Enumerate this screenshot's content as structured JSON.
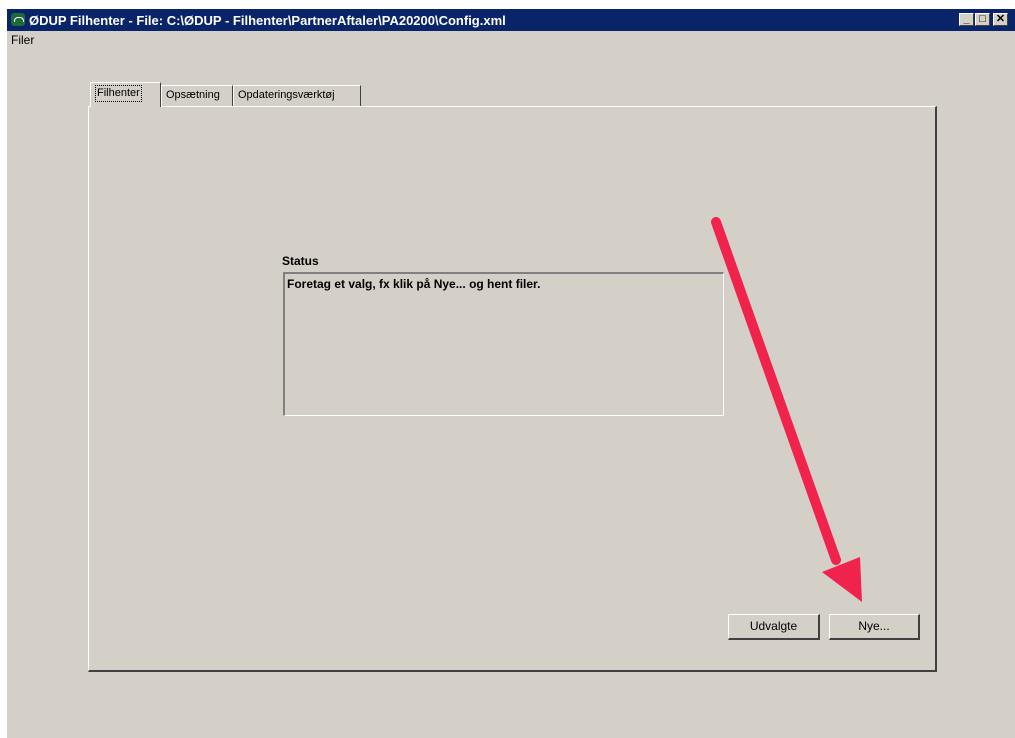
{
  "window": {
    "title": "ØDUP Filhenter - File: C:\\ØDUP - Filhenter\\PartnerAftaler\\PA20200\\Config.xml",
    "icon": "app-logo-icon",
    "controls": {
      "minimize": "_",
      "maximize": "□",
      "close": "✕"
    }
  },
  "menu": {
    "items": [
      {
        "label": "Filer"
      }
    ]
  },
  "tabs": [
    {
      "label": "Filhenter",
      "active": true
    },
    {
      "label": "Opsætning",
      "active": false
    },
    {
      "label": "Opdateringsværktøj",
      "active": false
    }
  ],
  "status": {
    "label": "Status",
    "text": "Foretag et valg, fx klik på Nye... og hent filer."
  },
  "buttons": {
    "selected_label": "Udvalgte",
    "new_label": "Nye..."
  },
  "annotation": {
    "type": "arrow",
    "color": "#f0234d",
    "points_to": "new-button"
  },
  "colors": {
    "titlebar": "#0a246a",
    "face": "#d4d0c8",
    "arrow": "#f0234d"
  }
}
